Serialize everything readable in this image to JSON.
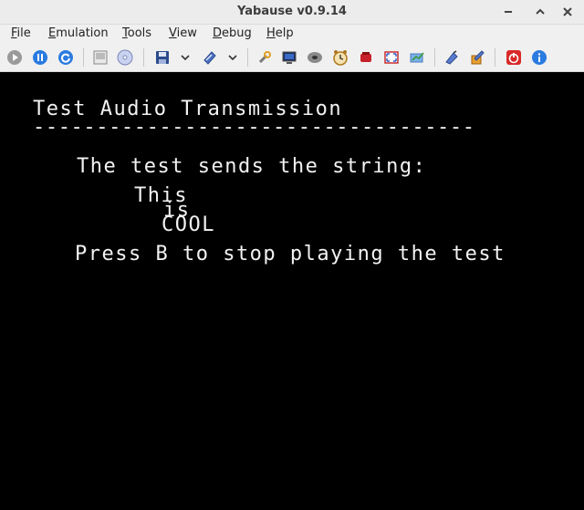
{
  "window": {
    "title": "Yabause v0.9.14"
  },
  "menu": {
    "items": [
      {
        "label": "File",
        "mnemonic": "F",
        "rest": "ile"
      },
      {
        "label": "Emulation",
        "mnemonic": "E",
        "rest": "mulation"
      },
      {
        "label": "Tools",
        "mnemonic": "T",
        "rest": "ools"
      },
      {
        "label": "View",
        "mnemonic": "V",
        "rest": "iew"
      },
      {
        "label": "Debug",
        "mnemonic": "D",
        "rest": "ebug"
      },
      {
        "label": "Help",
        "mnemonic": "H",
        "rest": "elp"
      }
    ]
  },
  "toolbar": {
    "icons": [
      "play-icon",
      "pause-icon",
      "reset-icon",
      "screenshot-icon",
      "open-cd-icon",
      "save-state-icon",
      "save-state-dropdown-icon",
      "load-state-icon",
      "load-state-dropdown-icon",
      "settings-icon",
      "backup-ram-icon",
      "cd-drive-icon",
      "clock-icon",
      "memory-icon",
      "fullscreen-icon",
      "framerate-icon",
      "debugger-icon",
      "memory-editor-icon",
      "quit-icon",
      "about-icon"
    ]
  },
  "screen": {
    "heading": "Test Audio Transmission",
    "rule": "-----------------------------------",
    "line1": "The test sends the string:",
    "word1": "This",
    "word2": "is",
    "word3": "COOL",
    "line2": "Press B to stop playing the test"
  },
  "colors": {
    "screen_bg": "#000000",
    "screen_text": "#f2f2f2",
    "chrome_bg": "#f0f0f0"
  }
}
